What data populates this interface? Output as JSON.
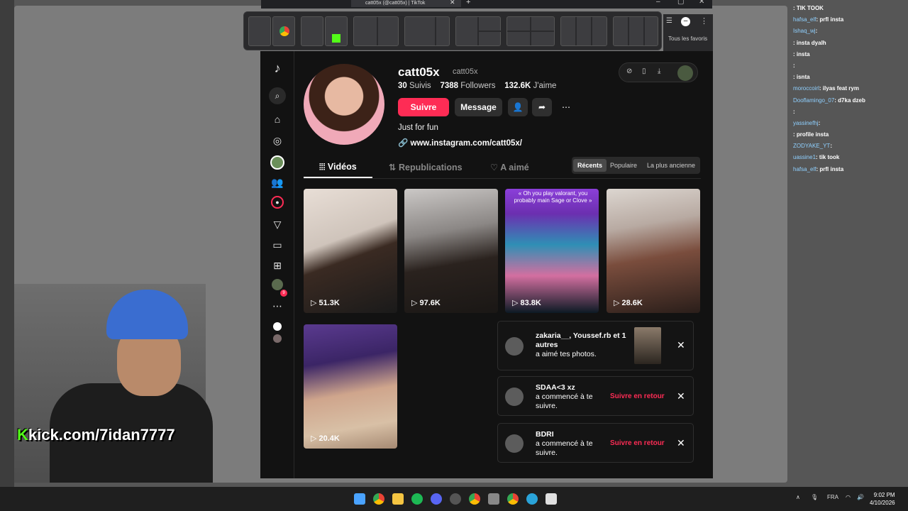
{
  "browser": {
    "tab_title": "catt05x (@catt05x) | TikTok",
    "bookmarks_label": "Tous les favoris"
  },
  "profile": {
    "username": "catt05x",
    "nickname": "catt05x",
    "following_count": "30",
    "following_label": "Suivis",
    "followers_count": "7388",
    "followers_label": "Followers",
    "likes_count": "132.6K",
    "likes_label": "J'aime",
    "follow_button": "Suivre",
    "message_button": "Message",
    "bio": "Just for fun",
    "link": "www.instagram.com/catt05x/"
  },
  "tabs": [
    {
      "label": "Vidéos",
      "icon": "grid-icon"
    },
    {
      "label": "Republications",
      "icon": "repost-icon"
    },
    {
      "label": "A aimé",
      "icon": "heart-lock-icon"
    }
  ],
  "sort_options": [
    "Récents",
    "Populaire",
    "La plus ancienne"
  ],
  "videos": [
    {
      "views": "51.3K"
    },
    {
      "views": "97.6K"
    },
    {
      "views": "83.8K",
      "caption": "« Oh you play valorant, you probably main Sage or Clove »"
    },
    {
      "views": "28.6K"
    },
    {
      "views": "20.4K"
    }
  ],
  "notifications": [
    {
      "name": "zakaria__, Youssef.rb et 1 autres",
      "action_text": "a aimé tes photos.",
      "button": ""
    },
    {
      "name": "SDAA<3 xz",
      "action_text": "a commencé à te suivre.",
      "button": "Suivre en retour"
    },
    {
      "name": "BDRI",
      "action_text": "a commencé à te suivre.",
      "button": "Suivre en retour"
    }
  ],
  "sidebar_badge": "9",
  "chat": [
    {
      "user": "",
      "msg": ": TIK TOOK"
    },
    {
      "user": "hafsa_elf",
      "msg": ": prfl insta"
    },
    {
      "user": "Ishaq_wj",
      "msg": ":"
    },
    {
      "user": "",
      "msg": ": insta dyalh"
    },
    {
      "user": "",
      "msg": ": insta"
    },
    {
      "user": "",
      "msg": ":"
    },
    {
      "user": "",
      "msg": ": isnta"
    },
    {
      "user": "moroccoirl",
      "msg": ": ilyas feat rym"
    },
    {
      "user": "Dooflamingo_07",
      "msg": ": d7ka dzeb"
    },
    {
      "user": "",
      "msg": ":"
    },
    {
      "user": "yassinefhj",
      "msg": ":"
    },
    {
      "user": "",
      "msg": ": profile insta"
    },
    {
      "user": "ZODYAKE_YT",
      "msg": ":"
    },
    {
      "user": "uassine1",
      "msg": ": tik took"
    },
    {
      "user": "hafsa_elf",
      "msg": ": prfl insta"
    }
  ],
  "stream": {
    "kick_letter": "K",
    "kick_url": "kick.com/7idan7777"
  },
  "taskbar": {
    "language": "FRA",
    "time": "9:02 PM",
    "date": "4/10/2026"
  },
  "colors": {
    "accent": "#fe2c55",
    "background": "#121212",
    "kick_green": "#53fc18"
  }
}
